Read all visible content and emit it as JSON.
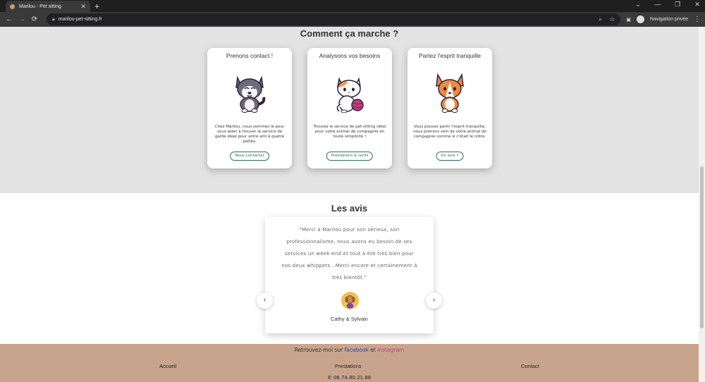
{
  "browser": {
    "tab_title": "Marilou - Pet sitting",
    "tab_close": "✕",
    "new_tab": "+",
    "url": "marilou-pet-sitting.fr",
    "private_label": "Navigation privée",
    "window_controls": [
      "⌄",
      "—",
      "❐",
      "✕"
    ]
  },
  "how_it_works": {
    "title": "Comment ça marche ?",
    "cards": [
      {
        "title": "Prenons contact !",
        "text": "Chez Marilou, nous sommes là pour vous aider à trouver le service de garde idéal pour votre ami à quatre pattes.",
        "button": "Nous contacter",
        "image": "husky-dog-illustration"
      },
      {
        "title": "Analysons vos besoins",
        "text": "Trouvez le service de pet-sitting idéal pour votre animal de compagnie en toute simplicité !",
        "button": "Prestations & tarifs",
        "image": "cat-with-yarn-illustration"
      },
      {
        "title": "Partez l'esprit tranquille",
        "text": "Vous pouvez partir l'esprit tranquille, nous prenons soin de votre animal de compagnie comme si c'était le nôtre.",
        "button": "Un avis ?",
        "image": "corgi-dog-illustration"
      }
    ]
  },
  "reviews": {
    "title": "Les avis",
    "quote": "\"Merci à Marilou pour son sérieux, son professionnalisme, nous avons eu besoin de ses services un week-end et tout à été très bien pour nos deux whippets . Merci encore et certainement à très bientôt.\"",
    "author": "Cathy & Sylvain",
    "prev_label": "‹",
    "next_label": "›"
  },
  "footer": {
    "social_prefix": "Retrouvez-moi sur",
    "facebook": "facebook",
    "and": "et",
    "instagram": "instagram",
    "links": [
      "Accueil",
      "Prestations",
      "Contact"
    ],
    "phone": "06.74.80.21.88"
  },
  "colors": {
    "footer_bg": "#c9a48d",
    "section_bg": "#e3e3e3",
    "button_accent": "#2f6b5e",
    "facebook": "#1f4fa8",
    "instagram": "#c93a87"
  }
}
